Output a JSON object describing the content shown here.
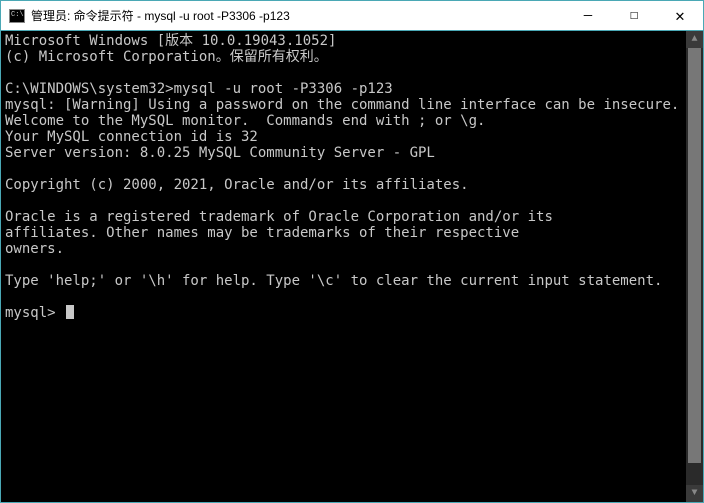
{
  "window": {
    "title": "管理员: 命令提示符 - mysql  -u root -P3306 -p123"
  },
  "terminal": {
    "lines": [
      "Microsoft Windows [版本 10.0.19043.1052]",
      "(c) Microsoft Corporation。保留所有权利。",
      "",
      "C:\\WINDOWS\\system32>mysql -u root -P3306 -p123",
      "mysql: [Warning] Using a password on the command line interface can be insecure.",
      "Welcome to the MySQL monitor.  Commands end with ; or \\g.",
      "Your MySQL connection id is 32",
      "Server version: 8.0.25 MySQL Community Server - GPL",
      "",
      "Copyright (c) 2000, 2021, Oracle and/or its affiliates.",
      "",
      "Oracle is a registered trademark of Oracle Corporation and/or its",
      "affiliates. Other names may be trademarks of their respective",
      "owners.",
      "",
      "Type 'help;' or '\\h' for help. Type '\\c' to clear the current input statement.",
      ""
    ],
    "prompt": "mysql>"
  },
  "buttons": {
    "minimize": "—",
    "maximize": "☐",
    "close": "✕"
  },
  "scroll": {
    "up": "▲",
    "down": "▼"
  }
}
